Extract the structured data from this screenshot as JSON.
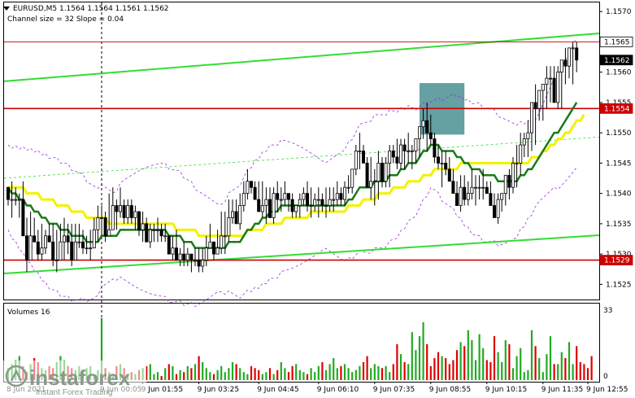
{
  "header": {
    "symbol_line": "EURUSD,M5  1.1564 1.1564 1.1561 1.1562",
    "indicator_line": "Channel size = 32 Slope = 0.04"
  },
  "volume_panel": {
    "title": "Volumes 16",
    "axis_max": "33",
    "axis_min": "0"
  },
  "watermark": {
    "brand": "instaforex",
    "tagline": "Instant Forex Trading"
  },
  "colors": {
    "bull": "#000000",
    "bear": "#000000",
    "ma_fast": "#1a7a1a",
    "ma_slow": "#f2f200",
    "channel": "#33dd33",
    "envelope": "#9b30d9",
    "level_line": "#cc0000",
    "volume_up": "#22aa22",
    "volume_down": "#dd0000",
    "zone": "#4a8f93"
  },
  "chart_data": {
    "type": "candlestick",
    "symbol": "EURUSD",
    "timeframe": "M5",
    "ylim": [
      1.15225,
      1.15715
    ],
    "y_ticks": [
      1.157,
      1.1565,
      1.156,
      1.1555,
      1.155,
      1.1545,
      1.154,
      1.1535,
      1.153,
      1.1525
    ],
    "y_tick_labels": [
      "1.1570",
      "1.1565",
      "1.1560",
      "1.1555",
      "1.1550",
      "1.1545",
      "1.1540",
      "1.1535",
      "1.1530",
      "1.1525"
    ],
    "x_tick_labels": [
      "8 Jun 2021",
      "9 Jun 00:05",
      "9 Jun 01:55",
      "9 Jun 03:25",
      "9 Jun 04:45",
      "9 Jun 06:10",
      "9 Jun 07:35",
      "9 Jun 08:55",
      "9 Jun 10:15",
      "9 Jun 11:35",
      "9 Jun 12:55"
    ],
    "x_tick_index": [
      0,
      25,
      36,
      51,
      67,
      83,
      98,
      113,
      128,
      143,
      155
    ],
    "price_labels": [
      {
        "value": 1.1565,
        "text": "1.1565",
        "style": "line"
      },
      {
        "value": 1.1562,
        "text": "1.1562",
        "style": "current"
      },
      {
        "value": 1.1554,
        "text": "1.1554",
        "style": "level"
      },
      {
        "value": 1.1529,
        "text": "1.1529",
        "style": "level"
      }
    ],
    "horizontal_levels": [
      1.1565,
      1.1554,
      1.1529
    ],
    "candles": {
      "o": [
        1.1541,
        1.1539,
        1.1539,
        1.1539,
        1.1539,
        1.1533,
        1.1529,
        1.1533,
        1.1532,
        1.153,
        1.1531,
        1.1533,
        1.1532,
        1.1529,
        1.1529,
        1.1532,
        1.1533,
        1.1532,
        1.1529,
        1.1532,
        1.1532,
        1.1531,
        1.1531,
        1.1531,
        1.1534,
        1.1536,
        1.1536,
        1.1533,
        1.1534,
        1.1538,
        1.1537,
        1.1538,
        1.1536,
        1.1538,
        1.1536,
        1.1537,
        1.1534,
        1.1535,
        1.1532,
        1.1534,
        1.1534,
        1.1534,
        1.1533,
        1.1533,
        1.153,
        1.1531,
        1.1529,
        1.153,
        1.1529,
        1.153,
        1.1529,
        1.1529,
        1.1528,
        1.1529,
        1.1531,
        1.1532,
        1.153,
        1.1531,
        1.1533,
        1.1533,
        1.1536,
        1.1537,
        1.1535,
        1.1538,
        1.154,
        1.1542,
        1.1541,
        1.1539,
        1.1537,
        1.1538,
        1.1539,
        1.1536,
        1.154,
        1.1539,
        1.1539,
        1.154,
        1.1539,
        1.1537,
        1.1538,
        1.1539,
        1.154,
        1.1538,
        1.1538,
        1.1539,
        1.1539,
        1.1538,
        1.1538,
        1.1539,
        1.1539,
        1.154,
        1.1539,
        1.1541,
        1.1541,
        1.1544,
        1.1547,
        1.1547,
        1.1545,
        1.1541,
        1.1542,
        1.1542,
        1.1545,
        1.1542,
        1.1545,
        1.1547,
        1.1546,
        1.1545,
        1.1548,
        1.1547,
        1.1547,
        1.1547,
        1.1549,
        1.1551,
        1.1552,
        1.155,
        1.1549,
        1.1546,
        1.1545,
        1.1545,
        1.1544,
        1.1542,
        1.154,
        1.1538,
        1.1541,
        1.1539,
        1.154,
        1.1541,
        1.1541,
        1.1541,
        1.1541,
        1.154,
        1.1538,
        1.1536,
        1.1539,
        1.154,
        1.1543,
        1.1541,
        1.1545,
        1.1545,
        1.1548,
        1.1549,
        1.155,
        1.1555,
        1.1554,
        1.1557,
        1.1558,
        1.1559,
        1.1559,
        1.1555,
        1.156,
        1.1562,
        1.1561,
        1.1564,
        1.1564
      ],
      "h": [
        1.1541,
        1.1542,
        1.1541,
        1.154,
        1.1542,
        1.1536,
        1.1537,
        1.1536,
        1.1534,
        1.1535,
        1.1534,
        1.1535,
        1.1535,
        1.1534,
        1.1535,
        1.1536,
        1.1535,
        1.1535,
        1.1535,
        1.1535,
        1.1534,
        1.1533,
        1.1534,
        1.1536,
        1.1538,
        1.1538,
        1.1537,
        1.154,
        1.1541,
        1.1539,
        1.1541,
        1.1539,
        1.1539,
        1.1539,
        1.1538,
        1.1537,
        1.1537,
        1.1536,
        1.1535,
        1.1535,
        1.1536,
        1.1535,
        1.1535,
        1.1533,
        1.1533,
        1.1534,
        1.1531,
        1.1532,
        1.1531,
        1.153,
        1.1531,
        1.1531,
        1.1531,
        1.1533,
        1.1535,
        1.1532,
        1.1534,
        1.1537,
        1.1537,
        1.1539,
        1.1539,
        1.1539,
        1.154,
        1.1542,
        1.1544,
        1.1542,
        1.1542,
        1.1542,
        1.1542,
        1.1541,
        1.1541,
        1.1541,
        1.1542,
        1.1541,
        1.1542,
        1.154,
        1.154,
        1.1538,
        1.154,
        1.1541,
        1.1542,
        1.1541,
        1.154,
        1.1541,
        1.154,
        1.1541,
        1.1541,
        1.1541,
        1.1542,
        1.1541,
        1.1542,
        1.1543,
        1.1544,
        1.1548,
        1.155,
        1.1548,
        1.1546,
        1.1546,
        1.1544,
        1.1547,
        1.1546,
        1.1546,
        1.1548,
        1.1548,
        1.1549,
        1.1549,
        1.1549,
        1.155,
        1.1548,
        1.1549,
        1.1551,
        1.1554,
        1.1555,
        1.1553,
        1.155,
        1.1548,
        1.1547,
        1.1547,
        1.1546,
        1.1544,
        1.1542,
        1.1543,
        1.1543,
        1.1542,
        1.1544,
        1.1543,
        1.1543,
        1.1544,
        1.1542,
        1.1542,
        1.154,
        1.154,
        1.154,
        1.1543,
        1.1544,
        1.1546,
        1.1548,
        1.155,
        1.155,
        1.1552,
        1.1555,
        1.1558,
        1.1557,
        1.1558,
        1.1561,
        1.1561,
        1.1561,
        1.1561,
        1.1562,
        1.1564,
        1.1563,
        1.1565,
        1.1565
      ],
      "l": [
        1.1538,
        1.1536,
        1.1538,
        1.1536,
        1.1533,
        1.1527,
        1.1529,
        1.1532,
        1.1529,
        1.1529,
        1.153,
        1.1532,
        1.1528,
        1.1527,
        1.1529,
        1.1529,
        1.153,
        1.1528,
        1.1529,
        1.1531,
        1.153,
        1.153,
        1.1529,
        1.1531,
        1.1532,
        1.1533,
        1.1532,
        1.1533,
        1.1534,
        1.1534,
        1.1536,
        1.1535,
        1.1535,
        1.1535,
        1.1534,
        1.1533,
        1.1532,
        1.1532,
        1.1531,
        1.1532,
        1.1532,
        1.1532,
        1.1532,
        1.153,
        1.1529,
        1.1529,
        1.1528,
        1.1528,
        1.1528,
        1.1527,
        1.1528,
        1.1527,
        1.1527,
        1.1528,
        1.1531,
        1.1529,
        1.153,
        1.153,
        1.153,
        1.1532,
        1.1535,
        1.1535,
        1.1534,
        1.1537,
        1.1539,
        1.154,
        1.1539,
        1.1537,
        1.1536,
        1.1535,
        1.1536,
        1.1535,
        1.1537,
        1.1537,
        1.1538,
        1.1537,
        1.1536,
        1.1536,
        1.1536,
        1.1538,
        1.1537,
        1.1536,
        1.1537,
        1.1536,
        1.1537,
        1.1536,
        1.1537,
        1.1537,
        1.1538,
        1.1538,
        1.1538,
        1.154,
        1.154,
        1.1543,
        1.1544,
        1.1545,
        1.1541,
        1.1539,
        1.1538,
        1.1539,
        1.1541,
        1.1541,
        1.1541,
        1.1545,
        1.1544,
        1.1544,
        1.1544,
        1.1545,
        1.1544,
        1.1545,
        1.1546,
        1.1549,
        1.1547,
        1.1548,
        1.1545,
        1.1544,
        1.1541,
        1.1543,
        1.1542,
        1.154,
        1.1538,
        1.1537,
        1.1538,
        1.1538,
        1.1539,
        1.1538,
        1.1539,
        1.1539,
        1.154,
        1.1538,
        1.1537,
        1.1535,
        1.1537,
        1.1538,
        1.1539,
        1.154,
        1.1541,
        1.1543,
        1.1546,
        1.1546,
        1.1547,
        1.1548,
        1.1552,
        1.1552,
        1.1554,
        1.1555,
        1.1557,
        1.1554,
        1.1554,
        1.1558,
        1.1559,
        1.1558,
        1.156,
        1.1561
      ],
      "c": [
        1.1539,
        1.1539,
        1.1539,
        1.1539,
        1.1533,
        1.1529,
        1.1533,
        1.1532,
        1.153,
        1.1531,
        1.1533,
        1.1532,
        1.1529,
        1.1529,
        1.1532,
        1.1533,
        1.1532,
        1.1529,
        1.1532,
        1.1532,
        1.1531,
        1.1531,
        1.1531,
        1.1534,
        1.1536,
        1.1536,
        1.1533,
        1.1534,
        1.1538,
        1.1537,
        1.1538,
        1.1536,
        1.1538,
        1.1536,
        1.1537,
        1.1534,
        1.1535,
        1.1532,
        1.1534,
        1.1534,
        1.1534,
        1.1533,
        1.1533,
        1.153,
        1.1531,
        1.1529,
        1.153,
        1.1529,
        1.153,
        1.1529,
        1.1529,
        1.1528,
        1.1529,
        1.1531,
        1.1532,
        1.153,
        1.1531,
        1.1533,
        1.1533,
        1.1536,
        1.1537,
        1.1535,
        1.1538,
        1.154,
        1.1542,
        1.1541,
        1.1539,
        1.1537,
        1.1538,
        1.1539,
        1.1536,
        1.154,
        1.1539,
        1.1539,
        1.154,
        1.1539,
        1.1537,
        1.1538,
        1.1539,
        1.154,
        1.1538,
        1.1538,
        1.1539,
        1.1539,
        1.1538,
        1.1538,
        1.1539,
        1.1539,
        1.154,
        1.1539,
        1.1541,
        1.1541,
        1.1544,
        1.1547,
        1.1547,
        1.1545,
        1.1541,
        1.1542,
        1.1542,
        1.1545,
        1.1542,
        1.1545,
        1.1547,
        1.1546,
        1.1545,
        1.1548,
        1.1547,
        1.1547,
        1.1547,
        1.1549,
        1.1551,
        1.1552,
        1.155,
        1.1549,
        1.1546,
        1.1545,
        1.1545,
        1.1544,
        1.1542,
        1.154,
        1.1538,
        1.1541,
        1.1539,
        1.154,
        1.1541,
        1.1541,
        1.1541,
        1.1541,
        1.154,
        1.1538,
        1.1536,
        1.1539,
        1.154,
        1.1543,
        1.1541,
        1.1545,
        1.1545,
        1.1548,
        1.1549,
        1.155,
        1.1555,
        1.1554,
        1.1557,
        1.1558,
        1.1559,
        1.1559,
        1.1555,
        1.156,
        1.1562,
        1.1561,
        1.1564,
        1.1564,
        1.1562
      ]
    },
    "ma_fast": [
      1.1541,
      1.154,
      1.154,
      1.1539,
      1.1539,
      1.1538,
      1.1538,
      1.1537,
      1.1537,
      1.1536,
      1.1536,
      1.1535,
      1.1535,
      1.1535,
      1.1534,
      1.1534,
      1.1534,
      1.1533,
      1.1533,
      1.1533,
      1.1533,
      1.1532,
      1.1532,
      1.1532,
      1.1532,
      1.1533,
      1.1533,
      1.1533,
      1.1533,
      1.1533,
      1.1534,
      1.1534,
      1.1534,
      1.1534,
      1.1534,
      1.1534,
      1.1534,
      1.1534,
      1.1534,
      1.1534,
      1.1534,
      1.1534,
      1.1534,
      1.1533,
      1.1533,
      1.1533,
      1.1533,
      1.1532,
      1.1532,
      1.1532,
      1.1531,
      1.1531,
      1.1531,
      1.1531,
      1.1531,
      1.1531,
      1.1531,
      1.1531,
      1.1531,
      1.1532,
      1.1532,
      1.1532,
      1.1532,
      1.1533,
      1.1534,
      1.1534,
      1.1535,
      1.1535,
      1.1536,
      1.1536,
      1.1537,
      1.1537,
      1.1537,
      1.1538,
      1.1538,
      1.1538,
      1.1538,
      1.1538,
      1.1538,
      1.1538,
      1.1538,
      1.1538,
      1.1538,
      1.1538,
      1.1538,
      1.1538,
      1.1538,
      1.1538,
      1.1538,
      1.1538,
      1.1538,
      1.1539,
      1.1539,
      1.154,
      1.1541,
      1.1541,
      1.1541,
      1.1541,
      1.1542,
      1.1542,
      1.1542,
      1.1542,
      1.1543,
      1.1543,
      1.1543,
      1.1544,
      1.1544,
      1.1545,
      1.1545,
      1.1545,
      1.1546,
      1.1547,
      1.1547,
      1.1548,
      1.1548,
      1.1548,
      1.1547,
      1.1547,
      1.1547,
      1.1547,
      1.1546,
      1.1546,
      1.1545,
      1.1545,
      1.1544,
      1.1544,
      1.1544,
      1.1543,
      1.1543,
      1.1543,
      1.1543,
      1.1542,
      1.1542,
      1.1542,
      1.1542,
      1.1542,
      1.1542,
      1.1543,
      1.1543,
      1.1544,
      1.1544,
      1.1545,
      1.1546,
      1.1547,
      1.1548,
      1.1549,
      1.155,
      1.155,
      1.1551,
      1.1552,
      1.1553,
      1.1554,
      1.1555
    ],
    "ma_slow": [
      1.1541,
      1.1541,
      1.1541,
      1.1541,
      1.1541,
      1.154,
      1.154,
      1.154,
      1.154,
      1.1539,
      1.1539,
      1.1539,
      1.1539,
      1.1538,
      1.1538,
      1.1538,
      1.1538,
      1.1537,
      1.1537,
      1.1537,
      1.1537,
      1.1536,
      1.1536,
      1.1536,
      1.1536,
      1.1536,
      1.1536,
      1.1535,
      1.1535,
      1.1535,
      1.1535,
      1.1535,
      1.1535,
      1.1535,
      1.1535,
      1.1535,
      1.1535,
      1.1535,
      1.1535,
      1.1535,
      1.1535,
      1.1535,
      1.1535,
      1.1535,
      1.1535,
      1.1534,
      1.1534,
      1.1534,
      1.1534,
      1.1534,
      1.1534,
      1.1533,
      1.1533,
      1.1533,
      1.1533,
      1.1533,
      1.1533,
      1.1533,
      1.1533,
      1.1533,
      1.1533,
      1.1533,
      1.1533,
      1.1533,
      1.1534,
      1.1534,
      1.1534,
      1.1534,
      1.1534,
      1.1535,
      1.1535,
      1.1535,
      1.1535,
      1.1535,
      1.1536,
      1.1536,
      1.1536,
      1.1536,
      1.1536,
      1.1536,
      1.1536,
      1.1537,
      1.1537,
      1.1537,
      1.1537,
      1.1537,
      1.1537,
      1.1537,
      1.1537,
      1.1537,
      1.1537,
      1.1538,
      1.1538,
      1.1538,
      1.1538,
      1.1539,
      1.1539,
      1.1539,
      1.1539,
      1.154,
      1.154,
      1.154,
      1.154,
      1.1541,
      1.1541,
      1.1541,
      1.1541,
      1.1542,
      1.1542,
      1.1542,
      1.1542,
      1.1543,
      1.1543,
      1.1543,
      1.1544,
      1.1544,
      1.1544,
      1.1544,
      1.1544,
      1.1544,
      1.1544,
      1.1545,
      1.1545,
      1.1545,
      1.1545,
      1.1545,
      1.1545,
      1.1545,
      1.1545,
      1.1545,
      1.1545,
      1.1545,
      1.1545,
      1.1545,
      1.1545,
      1.1545,
      1.1545,
      1.1545,
      1.1545,
      1.1545,
      1.1546,
      1.1546,
      1.1546,
      1.1547,
      1.1547,
      1.1548,
      1.1548,
      1.1549,
      1.1549,
      1.155,
      1.155,
      1.1551,
      1.1552,
      1.1552,
      1.1553
    ],
    "volumes": [
      6,
      8,
      10,
      12,
      7,
      4,
      8,
      11,
      9,
      6,
      5,
      7,
      6,
      9,
      12,
      10,
      7,
      6,
      5,
      7,
      4,
      6,
      7,
      3,
      5,
      31,
      6,
      4,
      3,
      7,
      8,
      6,
      3,
      4,
      3,
      5,
      6,
      7,
      8,
      3,
      4,
      2,
      6,
      8,
      7,
      3,
      5,
      4,
      7,
      6,
      8,
      12,
      9,
      6,
      4,
      3,
      5,
      7,
      4,
      6,
      9,
      8,
      6,
      4,
      3,
      7,
      6,
      5,
      3,
      4,
      6,
      3,
      5,
      9,
      6,
      4,
      7,
      8,
      5,
      4,
      3,
      6,
      4,
      7,
      9,
      5,
      8,
      11,
      6,
      7,
      8,
      6,
      4,
      5,
      7,
      9,
      12,
      6,
      8,
      7,
      6,
      7,
      4,
      8,
      18,
      13,
      9,
      8,
      24,
      15,
      22,
      29,
      18,
      7,
      11,
      14,
      12,
      11,
      8,
      10,
      15,
      19,
      17,
      25,
      20,
      10,
      23,
      16,
      10,
      9,
      22,
      14,
      9,
      20,
      18,
      6,
      12,
      16,
      4,
      5,
      25,
      17,
      11,
      4,
      13,
      22,
      8,
      8,
      14,
      11,
      19,
      8,
      17,
      9,
      8,
      6,
      12
    ],
    "volume_ylim": [
      0,
      33
    ]
  }
}
